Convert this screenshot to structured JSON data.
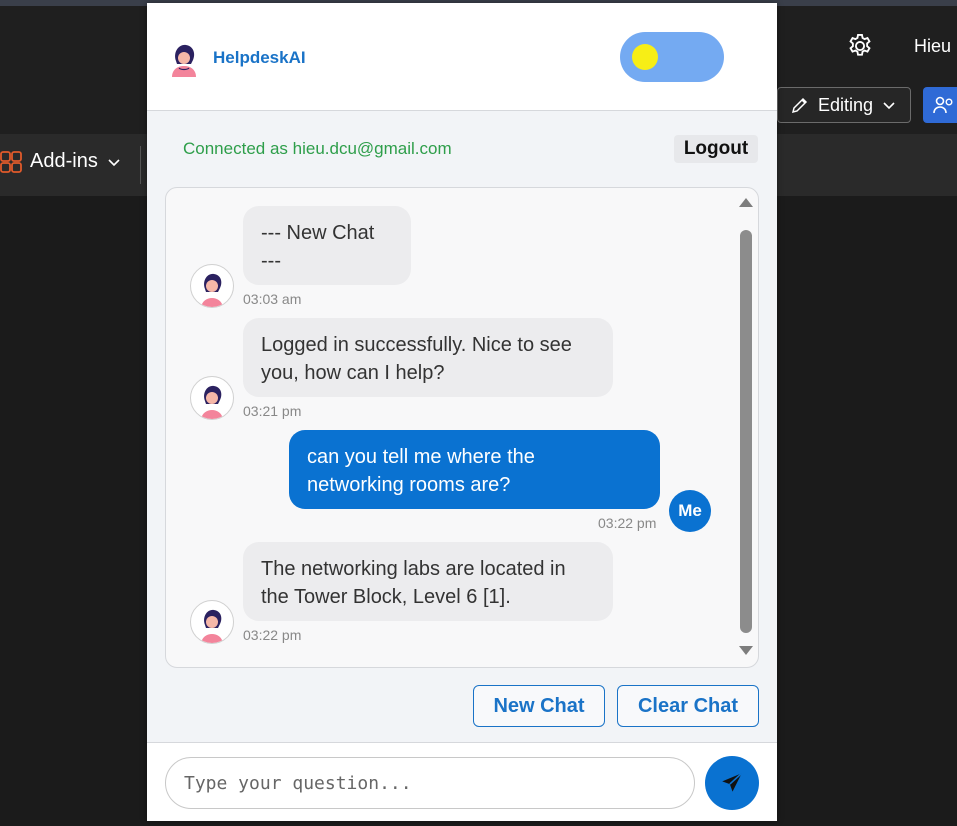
{
  "host": {
    "user_name": "Hieu",
    "editing_label": "Editing",
    "addins_label": "Add-ins"
  },
  "panel": {
    "brand_name": "HelpdeskAI",
    "connected_text": "Connected as hieu.dcu@gmail.com",
    "logout_label": "Logout",
    "me_label": "Me",
    "new_chat_label": "New Chat",
    "clear_chat_label": "Clear Chat",
    "input_placeholder": "Type your question..."
  },
  "messages": [
    {
      "sender": "bot",
      "text_line1": "--- New Chat",
      "text_line2": "---",
      "time": "03:03 am"
    },
    {
      "sender": "bot",
      "text_line1": "Logged in successfully. Nice to see",
      "text_line2": "you, how can I help?",
      "time": "03:21 pm"
    },
    {
      "sender": "me",
      "text_line1": "can you tell me where the",
      "text_line2": "networking rooms are?",
      "time": "03:22 pm"
    },
    {
      "sender": "bot",
      "text_line1": "The networking labs are located in",
      "text_line2": "the Tower Block, Level 6 [1].",
      "time": "03:22 pm"
    }
  ],
  "colors": {
    "accent": "#0a72d1",
    "brand": "#1a73c7",
    "connected": "#2e9e4a",
    "toggle_track": "#74aaf2",
    "toggle_knob": "#f7ee16"
  },
  "icons": {
    "settings": "gear-icon",
    "send": "paper-plane-icon",
    "editing": "pencil-icon",
    "addins": "grid-icon"
  }
}
